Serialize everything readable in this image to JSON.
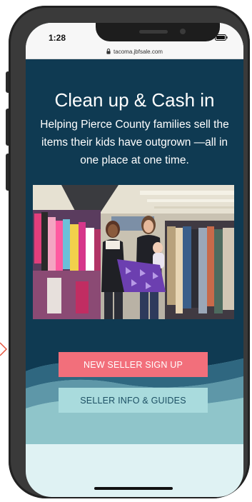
{
  "status_bar": {
    "time": "1:28"
  },
  "browser": {
    "url": "tacoma.jbfsale.com"
  },
  "hero": {
    "headline": "Clean up & Cash in",
    "subhead": "Helping Pierce County families sell the items their kids have outgrown —all in one place at one time."
  },
  "actions": {
    "signup_label": "NEW SELLER SIGN UP",
    "info_label": "SELLER INFO & GUIDES"
  },
  "colors": {
    "hero_bg": "#0f3a52",
    "primary_button": "#f26f7b",
    "secondary_button": "#a9dbdd",
    "page_bg": "#dff2f3"
  },
  "icons": [
    "lock-icon",
    "signal-icon",
    "wifi-icon",
    "battery-icon"
  ]
}
